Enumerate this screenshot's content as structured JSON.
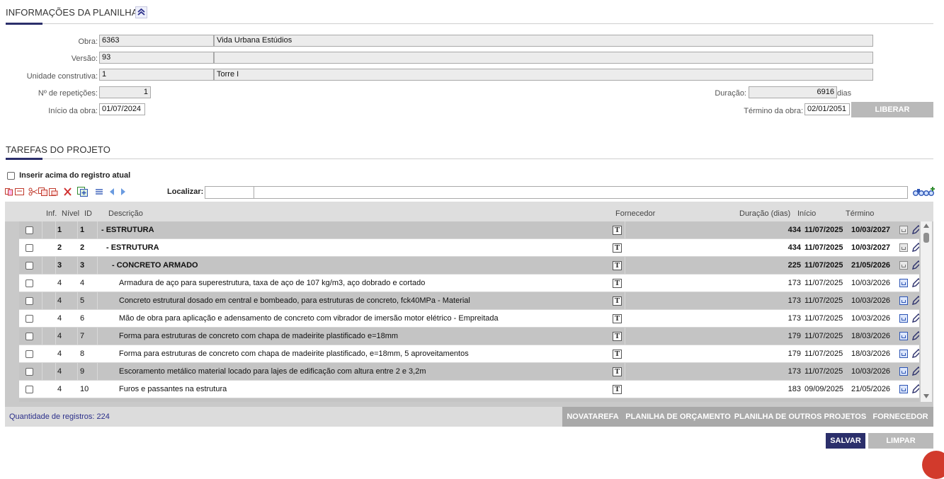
{
  "info": {
    "title": "INFORMAÇÕES DA PLANILHA",
    "obra_label": "Obra:",
    "obra_code": "6363",
    "obra_name": "Vida Urbana Estúdios",
    "versao_label": "Versão:",
    "versao": "93",
    "versao_desc": "",
    "unidade_label": "Unidade construtiva:",
    "unidade_code": "1",
    "unidade_name": "Torre I",
    "repeticoes_label": "Nº de repetições:",
    "repeticoes": "1",
    "duracao_label": "Duração:",
    "duracao": "6916",
    "duracao_unit": "dias",
    "inicio_label": "Início da obra:",
    "inicio": "01/07/2024",
    "termino_label": "Término da obra:",
    "termino": "02/01/2051",
    "liberar_label": "LIBERAR PLANILHA"
  },
  "tasks": {
    "title": "TAREFAS DO PROJETO",
    "insert_above_label": "Inserir acima do registro atual",
    "search_label": "Localizar:",
    "search_value": "",
    "columns": {
      "inf": "Inf.",
      "nivel": "Nível",
      "id": "ID",
      "descricao": "Descrição",
      "fornecedor": "Fornecedor",
      "duracao": "Duração (dias)",
      "inicio": "Início",
      "termino": "Término"
    },
    "rows": [
      {
        "nivel": "1",
        "id": "1",
        "desc": "- ESTRUTURA",
        "forn": "T",
        "dur": "434",
        "ini": "11/07/2025",
        "fim": "10/03/2027"
      },
      {
        "nivel": "2",
        "id": "2",
        "desc": "- ESTRUTURA",
        "forn": "T",
        "dur": "434",
        "ini": "11/07/2025",
        "fim": "10/03/2027"
      },
      {
        "nivel": "3",
        "id": "3",
        "desc": "- CONCRETO ARMADO",
        "forn": "T",
        "dur": "225",
        "ini": "11/07/2025",
        "fim": "21/05/2026"
      },
      {
        "nivel": "4",
        "id": "4",
        "desc": "Armadura de aço para superestrutura, taxa de aço de 107 kg/m3, aço dobrado e cortado",
        "forn": "T",
        "dur": "173",
        "ini": "11/07/2025",
        "fim": "10/03/2026"
      },
      {
        "nivel": "4",
        "id": "5",
        "desc": "Concreto estrutural dosado em central e bombeado, para estruturas de concreto, fck40MPa - Material",
        "forn": "T",
        "dur": "173",
        "ini": "11/07/2025",
        "fim": "10/03/2026"
      },
      {
        "nivel": "4",
        "id": "6",
        "desc": "Mão de obra para aplicação e adensamento de concreto com vibrador de imersão motor elétrico - Empreitada",
        "forn": "T",
        "dur": "173",
        "ini": "11/07/2025",
        "fim": "10/03/2026"
      },
      {
        "nivel": "4",
        "id": "7",
        "desc": "Forma para estruturas de concreto com chapa de madeirite plastificado e=18mm",
        "forn": "T",
        "dur": "179",
        "ini": "11/07/2025",
        "fim": "18/03/2026"
      },
      {
        "nivel": "4",
        "id": "8",
        "desc": "Forma para estruturas de concreto com chapa de madeirite plastificado, e=18mm, 5 aproveitamentos",
        "forn": "T",
        "dur": "179",
        "ini": "11/07/2025",
        "fim": "18/03/2026"
      },
      {
        "nivel": "4",
        "id": "9",
        "desc": "Escoramento metálico material locado para lajes de edificação com altura entre 2 e 3,2m",
        "forn": "T",
        "dur": "173",
        "ini": "11/07/2025",
        "fim": "10/03/2026"
      },
      {
        "nivel": "4",
        "id": "10",
        "desc": "Furos e passantes na estrutura",
        "forn": "T",
        "dur": "183",
        "ini": "09/09/2025",
        "fim": "21/05/2026"
      }
    ],
    "record_count": "Quantidade de registros: 224",
    "footer_buttons": [
      "NOVATAREFA",
      "PLANILHA DE ORÇAMENTO",
      "PLANILHA DE OUTROS PROJETOS",
      "FORNECEDOR"
    ]
  },
  "actions": {
    "save": "SALVAR",
    "clear_dates": "LIMPAR DATAS"
  },
  "colors": {
    "navy": "#2b2f6b",
    "row_gray": "#c4c4c4",
    "button_gray": "#b9b9b9"
  }
}
